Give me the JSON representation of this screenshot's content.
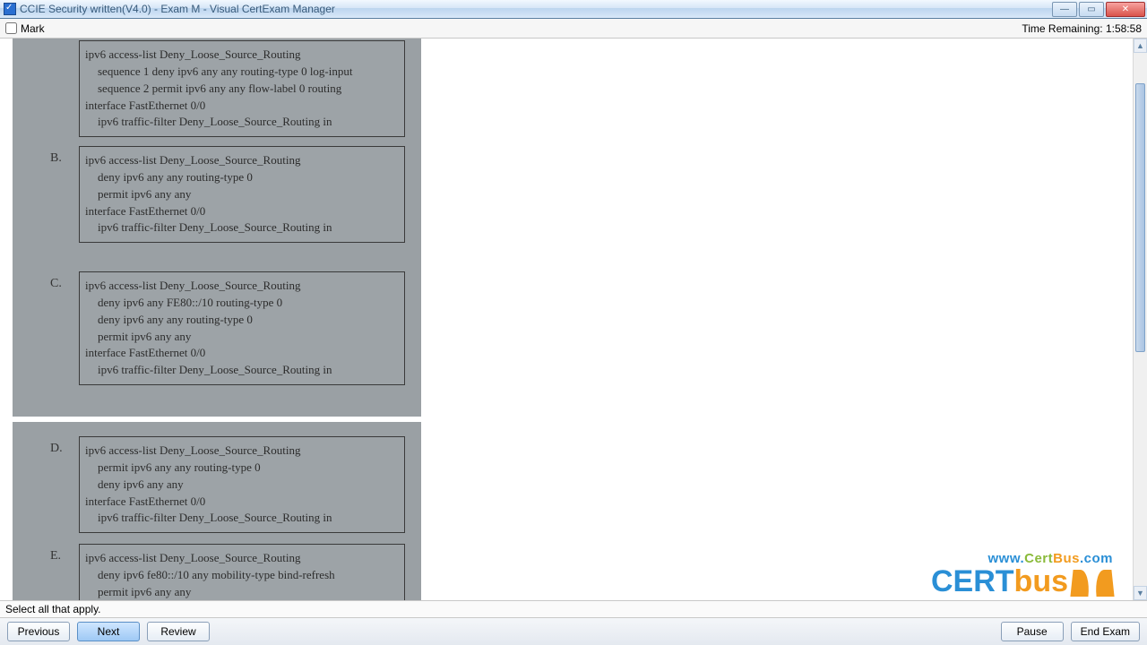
{
  "window": {
    "title": "CCIE Security written(V4.0) - Exam M - Visual CertExam Manager"
  },
  "toolbar": {
    "mark_label": "Mark",
    "time_label": "Time Remaining:",
    "time_value": "1:58:58"
  },
  "instruction": "Select all that apply.",
  "buttons": {
    "previous": "Previous",
    "next": "Next",
    "review": "Review",
    "pause": "Pause",
    "end_exam": "End Exam"
  },
  "watermark": {
    "url_www": "www.",
    "url_cert": "Cert",
    "url_bus": "Bus",
    "url_com": ".com",
    "brand_cert": "CERT",
    "brand_bus": "bus"
  },
  "answers": {
    "A": {
      "label": "",
      "lines": [
        {
          "cls": "",
          "t": "ipv6 access-list Deny_Loose_Source_Routing"
        },
        {
          "cls": "ind1",
          "t": "sequence 1 deny ipv6 any any routing-type 0 log-input"
        },
        {
          "cls": "ind1",
          "t": "sequence 2 permit ipv6 any any flow-label 0 routing"
        },
        {
          "cls": "",
          "t": "interface FastEthernet 0/0"
        },
        {
          "cls": "ind1",
          "t": "ipv6 traffic-filter Deny_Loose_Source_Routing in"
        }
      ]
    },
    "B": {
      "label": "B.",
      "lines": [
        {
          "cls": "",
          "t": "ipv6 access-list Deny_Loose_Source_Routing"
        },
        {
          "cls": "ind1",
          "t": "deny ipv6 any any routing-type 0"
        },
        {
          "cls": "ind1",
          "t": "permit ipv6 any any"
        },
        {
          "cls": "",
          "t": "interface FastEthernet 0/0"
        },
        {
          "cls": "ind1",
          "t": "ipv6 traffic-filter Deny_Loose_Source_Routing in"
        }
      ]
    },
    "C": {
      "label": "C.",
      "lines": [
        {
          "cls": "",
          "t": "ipv6 access-list Deny_Loose_Source_Routing"
        },
        {
          "cls": "ind1",
          "t": "deny ipv6 any FE80::/10 routing-type 0"
        },
        {
          "cls": "ind1",
          "t": "deny ipv6 any any routing-type 0"
        },
        {
          "cls": "ind1",
          "t": "permit ipv6 any any"
        },
        {
          "cls": "",
          "t": "interface FastEthernet 0/0"
        },
        {
          "cls": "ind1",
          "t": "ipv6 traffic-filter Deny_Loose_Source_Routing in"
        }
      ]
    },
    "D": {
      "label": "D.",
      "lines": [
        {
          "cls": "",
          "t": "ipv6 access-list Deny_Loose_Source_Routing"
        },
        {
          "cls": "ind1",
          "t": "permit ipv6 any any routing-type 0"
        },
        {
          "cls": "ind1",
          "t": "deny ipv6 any any"
        },
        {
          "cls": "",
          "t": "interface FastEthernet 0/0"
        },
        {
          "cls": "ind1",
          "t": "ipv6 traffic-filter Deny_Loose_Source_Routing in"
        }
      ]
    },
    "E": {
      "label": "E.",
      "lines": [
        {
          "cls": "",
          "t": "ipv6 access-list Deny_Loose_Source_Routing"
        },
        {
          "cls": "ind1",
          "t": "deny ipv6 fe80::/10 any mobility-type bind-refresh"
        },
        {
          "cls": "ind1",
          "t": "permit ipv6 any any"
        }
      ]
    }
  }
}
